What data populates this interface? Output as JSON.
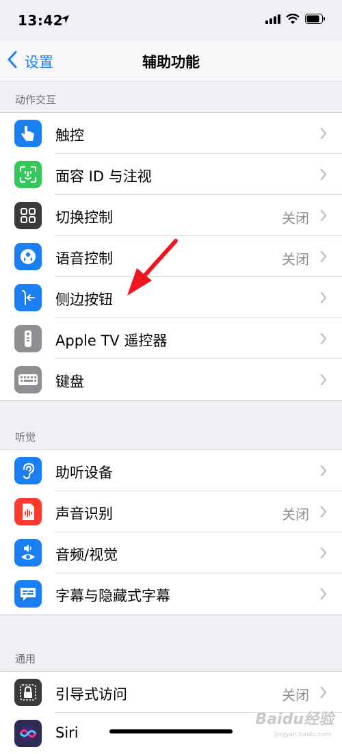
{
  "status": {
    "time": "13:42"
  },
  "nav": {
    "back_label": "设置",
    "title": "辅助功能"
  },
  "sections": [
    {
      "header": "动作交互",
      "items": [
        {
          "label": "触控",
          "value": "",
          "icon": "hand-tap-icon",
          "color": "#1a7ef5"
        },
        {
          "label": "面容 ID 与注视",
          "value": "",
          "icon": "face-id-icon",
          "color": "#34c759"
        },
        {
          "label": "切换控制",
          "value": "关闭",
          "icon": "switch-control-icon",
          "color": "#3a3a3c"
        },
        {
          "label": "语音控制",
          "value": "关闭",
          "icon": "voice-control-icon",
          "color": "#1a7ef5"
        },
        {
          "label": "侧边按钮",
          "value": "",
          "icon": "side-button-icon",
          "color": "#1a7ef5"
        },
        {
          "label": "Apple TV 遥控器",
          "value": "",
          "icon": "remote-icon",
          "color": "#8e8e93"
        },
        {
          "label": "键盘",
          "value": "",
          "icon": "keyboard-icon",
          "color": "#8e8e93"
        }
      ]
    },
    {
      "header": "听觉",
      "items": [
        {
          "label": "助听设备",
          "value": "",
          "icon": "ear-icon",
          "color": "#1a7ef5"
        },
        {
          "label": "声音识别",
          "value": "关闭",
          "icon": "sound-recognition-icon",
          "color": "#ff3b30"
        },
        {
          "label": "音频/视觉",
          "value": "",
          "icon": "audio-visual-icon",
          "color": "#1a7ef5"
        },
        {
          "label": "字幕与隐藏式字幕",
          "value": "",
          "icon": "captions-icon",
          "color": "#1a7ef5"
        }
      ]
    },
    {
      "header": "通用",
      "items": [
        {
          "label": "引导式访问",
          "value": "关闭",
          "icon": "guided-access-icon",
          "color": "#3a3a3c"
        },
        {
          "label": "Siri",
          "value": "",
          "icon": "siri-icon",
          "color": "#2c2c54"
        }
      ]
    }
  ],
  "watermark": {
    "text": "Baidu经验",
    "sub": "jingyan.baidu.com"
  }
}
